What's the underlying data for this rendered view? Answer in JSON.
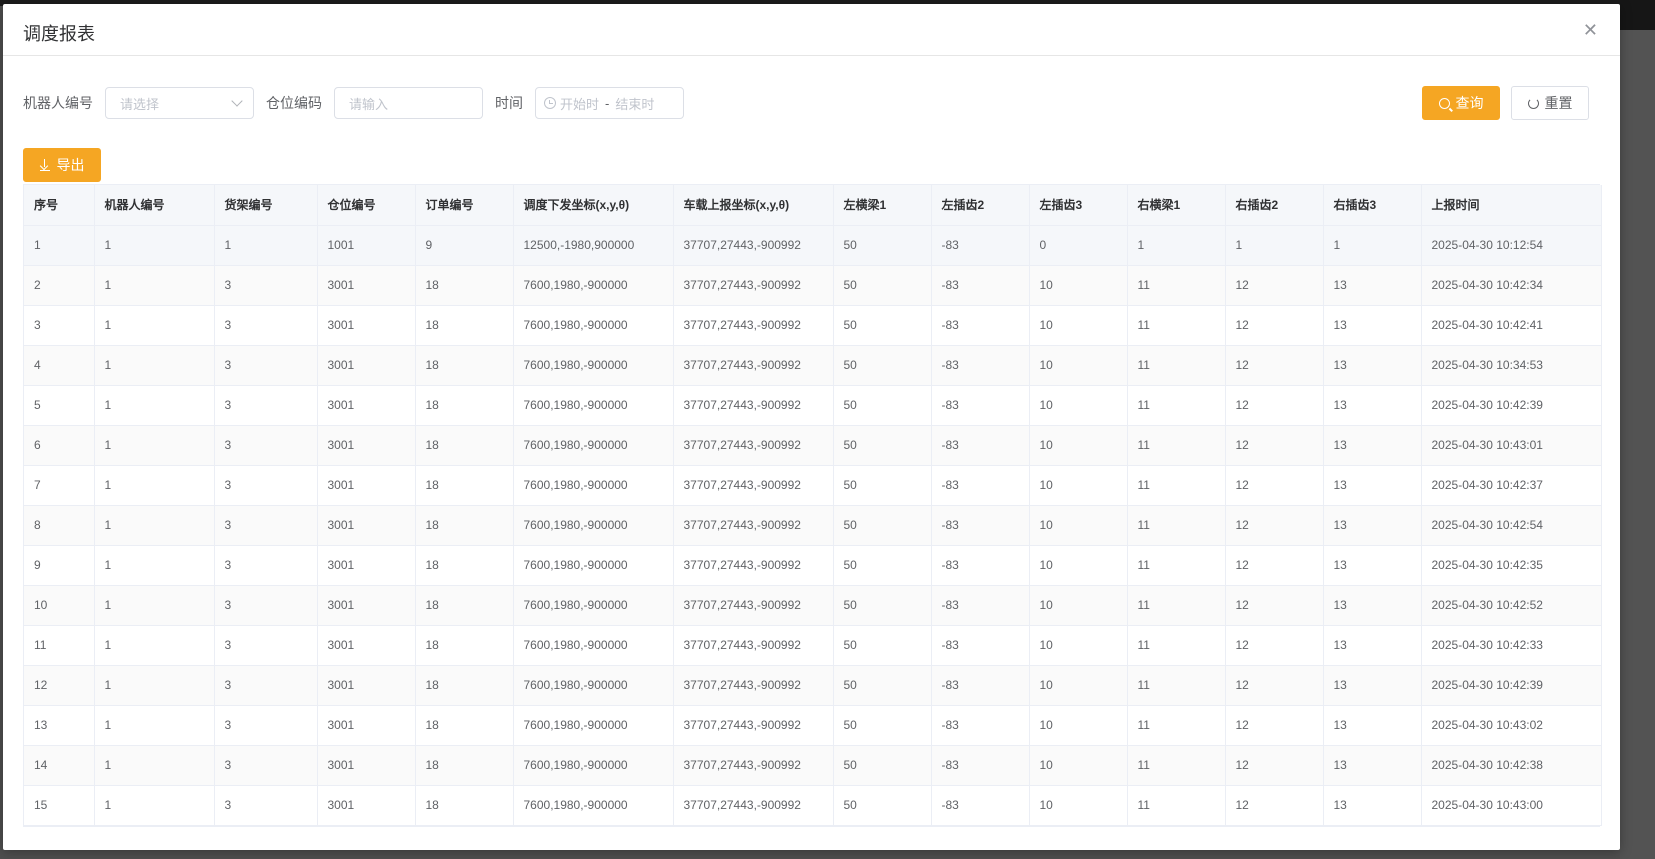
{
  "modal": {
    "title": "调度报表",
    "close_icon": "close-icon"
  },
  "filters": {
    "robot_label": "机器人编号",
    "robot_placeholder": "请选择",
    "location_label": "仓位编码",
    "location_placeholder": "请输入",
    "time_label": "时间",
    "time_start_placeholder": "开始时",
    "time_separator": "-",
    "time_end_placeholder": "结束时"
  },
  "buttons": {
    "query": "查询",
    "reset": "重置",
    "export": "导出"
  },
  "colors": {
    "accent": "#f5a623",
    "header_bg": "#f5f7fa",
    "border": "#ebeef5"
  },
  "table": {
    "columns": [
      "序号",
      "机器人编号",
      "货架编号",
      "仓位编号",
      "订单编号",
      "调度下发坐标(x,y,θ)",
      "车载上报坐标(x,y,θ)",
      "左横梁1",
      "左插齿2",
      "左插齿3",
      "右横梁1",
      "右插齿2",
      "右插齿3",
      "上报时间"
    ],
    "rows": [
      [
        "1",
        "1",
        "1",
        "1001",
        "9",
        "12500,-1980,900000",
        "37707,27443,-900992",
        "50",
        "-83",
        "0",
        "1",
        "1",
        "1",
        "2025-04-30 10:12:54"
      ],
      [
        "2",
        "1",
        "3",
        "3001",
        "18",
        "7600,1980,-900000",
        "37707,27443,-900992",
        "50",
        "-83",
        "10",
        "11",
        "12",
        "13",
        "2025-04-30 10:42:34"
      ],
      [
        "3",
        "1",
        "3",
        "3001",
        "18",
        "7600,1980,-900000",
        "37707,27443,-900992",
        "50",
        "-83",
        "10",
        "11",
        "12",
        "13",
        "2025-04-30 10:42:41"
      ],
      [
        "4",
        "1",
        "3",
        "3001",
        "18",
        "7600,1980,-900000",
        "37707,27443,-900992",
        "50",
        "-83",
        "10",
        "11",
        "12",
        "13",
        "2025-04-30 10:34:53"
      ],
      [
        "5",
        "1",
        "3",
        "3001",
        "18",
        "7600,1980,-900000",
        "37707,27443,-900992",
        "50",
        "-83",
        "10",
        "11",
        "12",
        "13",
        "2025-04-30 10:42:39"
      ],
      [
        "6",
        "1",
        "3",
        "3001",
        "18",
        "7600,1980,-900000",
        "37707,27443,-900992",
        "50",
        "-83",
        "10",
        "11",
        "12",
        "13",
        "2025-04-30 10:43:01"
      ],
      [
        "7",
        "1",
        "3",
        "3001",
        "18",
        "7600,1980,-900000",
        "37707,27443,-900992",
        "50",
        "-83",
        "10",
        "11",
        "12",
        "13",
        "2025-04-30 10:42:37"
      ],
      [
        "8",
        "1",
        "3",
        "3001",
        "18",
        "7600,1980,-900000",
        "37707,27443,-900992",
        "50",
        "-83",
        "10",
        "11",
        "12",
        "13",
        "2025-04-30 10:42:54"
      ],
      [
        "9",
        "1",
        "3",
        "3001",
        "18",
        "7600,1980,-900000",
        "37707,27443,-900992",
        "50",
        "-83",
        "10",
        "11",
        "12",
        "13",
        "2025-04-30 10:42:35"
      ],
      [
        "10",
        "1",
        "3",
        "3001",
        "18",
        "7600,1980,-900000",
        "37707,27443,-900992",
        "50",
        "-83",
        "10",
        "11",
        "12",
        "13",
        "2025-04-30 10:42:52"
      ],
      [
        "11",
        "1",
        "3",
        "3001",
        "18",
        "7600,1980,-900000",
        "37707,27443,-900992",
        "50",
        "-83",
        "10",
        "11",
        "12",
        "13",
        "2025-04-30 10:42:33"
      ],
      [
        "12",
        "1",
        "3",
        "3001",
        "18",
        "7600,1980,-900000",
        "37707,27443,-900992",
        "50",
        "-83",
        "10",
        "11",
        "12",
        "13",
        "2025-04-30 10:42:39"
      ],
      [
        "13",
        "1",
        "3",
        "3001",
        "18",
        "7600,1980,-900000",
        "37707,27443,-900992",
        "50",
        "-83",
        "10",
        "11",
        "12",
        "13",
        "2025-04-30 10:43:02"
      ],
      [
        "14",
        "1",
        "3",
        "3001",
        "18",
        "7600,1980,-900000",
        "37707,27443,-900992",
        "50",
        "-83",
        "10",
        "11",
        "12",
        "13",
        "2025-04-30 10:42:38"
      ],
      [
        "15",
        "1",
        "3",
        "3001",
        "18",
        "7600,1980,-900000",
        "37707,27443,-900992",
        "50",
        "-83",
        "10",
        "11",
        "12",
        "13",
        "2025-04-30 10:43:00"
      ]
    ]
  }
}
